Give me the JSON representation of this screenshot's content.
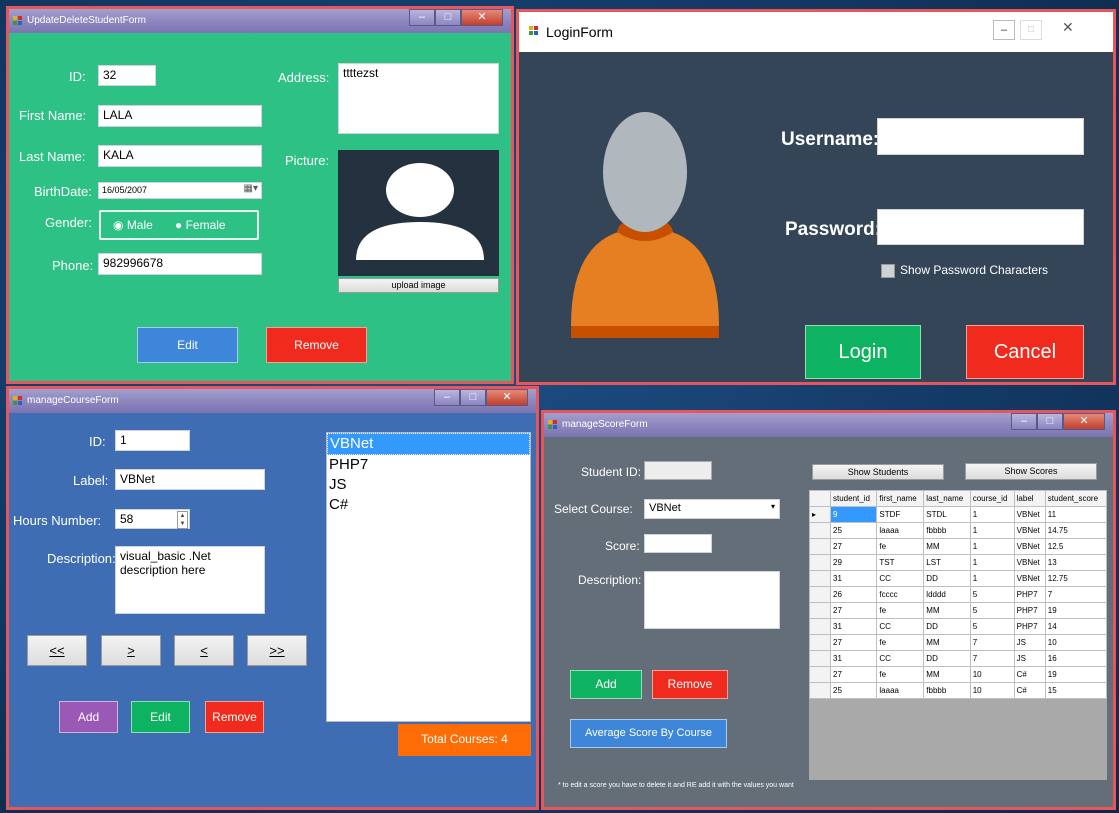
{
  "update_form": {
    "title": "UpdateDeleteStudentForm",
    "id_label": "ID:",
    "id_value": "32",
    "first_name_label": "First Name:",
    "first_name_value": "LALA",
    "last_name_label": "Last Name:",
    "last_name_value": "KALA",
    "birthdate_label": "BirthDate:",
    "birthdate_value": "16/05/2007",
    "gender_label": "Gender:",
    "male_label": "Male",
    "female_label": "Female",
    "phone_label": "Phone:",
    "phone_value": "982996678",
    "address_label": "Address:",
    "address_value": "ttttezst",
    "picture_label": "Picture:",
    "upload_label": "upload image",
    "edit_label": "Edit",
    "remove_label": "Remove"
  },
  "login_form": {
    "title": "LoginForm",
    "username_label": "Username:",
    "password_label": "Password:",
    "show_password_label": "Show Password Characters",
    "login_label": "Login",
    "cancel_label": "Cancel"
  },
  "course_form": {
    "title": "manageCourseForm",
    "id_label": "ID:",
    "id_value": "1",
    "label_label": "Label:",
    "label_value": "VBNet",
    "hours_label": "Hours Number:",
    "hours_value": "58",
    "description_label": "Description:",
    "description_value": "visual_basic .Net description here",
    "nav_first": "<<",
    "nav_next": ">",
    "nav_prev": "<",
    "nav_last": ">>",
    "add_label": "Add",
    "edit_label": "Edit",
    "remove_label": "Remove",
    "courses": [
      "VBNet",
      "PHP7",
      "JS",
      "C#"
    ],
    "total_label": "Total Courses: 4"
  },
  "score_form": {
    "title": "manageScoreForm",
    "student_id_label": "Student ID:",
    "select_course_label": "Select Course:",
    "course_value": "VBNet",
    "score_label": "Score:",
    "description_label": "Description:",
    "show_students_label": "Show Students",
    "show_scores_label": "Show Scores",
    "add_label": "Add",
    "remove_label": "Remove",
    "average_label": "Average Score By Course",
    "note": "* to edit a score you have to delete it and RE add it with the values you want",
    "columns": [
      "student_id",
      "first_name",
      "last_name",
      "course_id",
      "label",
      "student_score"
    ],
    "rows": [
      [
        "9",
        "STDF",
        "STDL",
        "1",
        "VBNet",
        "11"
      ],
      [
        "25",
        "laaaa",
        "fbbbb",
        "1",
        "VBNet",
        "14.75"
      ],
      [
        "27",
        "fe",
        "MM",
        "1",
        "VBNet",
        "12.5"
      ],
      [
        "29",
        "TST",
        "LST",
        "1",
        "VBNet",
        "13"
      ],
      [
        "31",
        "CC",
        "DD",
        "1",
        "VBNet",
        "12.75"
      ],
      [
        "26",
        "fcccc",
        "ldddd",
        "5",
        "PHP7",
        "7"
      ],
      [
        "27",
        "fe",
        "MM",
        "5",
        "PHP7",
        "19"
      ],
      [
        "31",
        "CC",
        "DD",
        "5",
        "PHP7",
        "14"
      ],
      [
        "27",
        "fe",
        "MM",
        "7",
        "JS",
        "10"
      ],
      [
        "31",
        "CC",
        "DD",
        "7",
        "JS",
        "16"
      ],
      [
        "27",
        "fe",
        "MM",
        "10",
        "C#",
        "19"
      ],
      [
        "25",
        "laaaa",
        "fbbbb",
        "10",
        "C#",
        "15"
      ]
    ]
  },
  "colors": {
    "update_bg": "#2dc186",
    "login_bg": "#344558",
    "course_bg": "#3f6db3",
    "score_bg": "#646e78",
    "frame_red": "#e8555a",
    "accent_red": "#f02b1e",
    "green_btn": "#0db360",
    "blue_btn": "#3e86d9",
    "purple_btn": "#9b59b6",
    "orange_btn": "#fe6d05"
  },
  "icons": [
    "app-icon",
    "minimize-icon",
    "maximize-icon",
    "close-icon",
    "user-avatar-icon",
    "calendar-dropdown-icon",
    "dropdown-arrow-icon",
    "row-selector-icon"
  ]
}
